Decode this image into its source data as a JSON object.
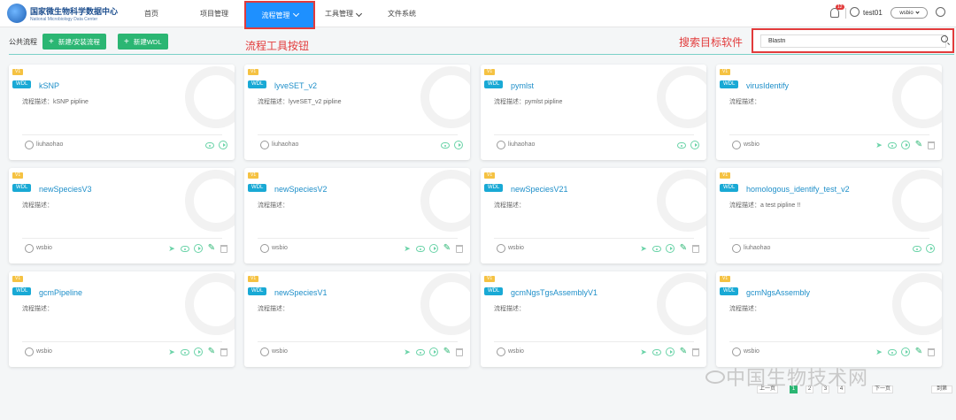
{
  "header": {
    "logo_title": "国家微生物科学数据中心",
    "logo_sub": "National Microbiology Data Center",
    "nav": [
      "首页",
      "项目管理",
      "流程管理",
      "工具管理",
      "文件系统"
    ],
    "notify_count": "12",
    "user": "test01",
    "workspace": "wsbio"
  },
  "toolbar": {
    "label": "公共流程",
    "new_flow": "新建/安装流程",
    "new_wdl": "新建WDL",
    "annotation_tools": "流程工具按钮",
    "annotation_search": "搜索目标软件",
    "search_value": "Blastn"
  },
  "cards": [
    {
      "version": "V1",
      "type": "WDL",
      "name": "kSNP",
      "desc": "流程描述：kSNP pipline",
      "owner": "liuhaohao",
      "actions": [
        "eye",
        "play"
      ]
    },
    {
      "version": "V1",
      "type": "WDL",
      "name": "lyveSET_v2",
      "desc": "流程描述：lyveSET_v2 pipline",
      "owner": "liuhaohao",
      "actions": [
        "eye",
        "play"
      ]
    },
    {
      "version": "V1",
      "type": "WDL",
      "name": "pymlst",
      "desc": "流程描述：pymlst pipline",
      "owner": "liuhaohao",
      "actions": [
        "eye",
        "play"
      ]
    },
    {
      "version": "V1",
      "type": "WDL",
      "name": "virusIdentify",
      "desc": "流程描述：",
      "owner": "wsbio",
      "actions": [
        "send",
        "eye",
        "play",
        "edit",
        "trash"
      ]
    },
    {
      "version": "V1",
      "type": "WDL",
      "name": "newSpeciesV3",
      "desc": "流程描述：",
      "owner": "wsbio",
      "actions": [
        "send",
        "eye",
        "play",
        "edit",
        "trash"
      ]
    },
    {
      "version": "V1",
      "type": "WDL",
      "name": "newSpeciesV2",
      "desc": "流程描述：",
      "owner": "wsbio",
      "actions": [
        "send",
        "eye",
        "play",
        "edit",
        "trash"
      ]
    },
    {
      "version": "V1",
      "type": "WDL",
      "name": "newSpeciesV21",
      "desc": "流程描述：",
      "owner": "wsbio",
      "actions": [
        "send",
        "eye",
        "play",
        "edit",
        "trash"
      ]
    },
    {
      "version": "V1",
      "type": "WDL",
      "name": "homologous_identify_test_v2",
      "desc": "流程描述：a test pipline !!",
      "owner": "liuhaohao",
      "actions": [
        "eye",
        "play"
      ]
    },
    {
      "version": "V1",
      "type": "WDL",
      "name": "gcmPipeline",
      "desc": "流程描述：",
      "owner": "wsbio",
      "actions": [
        "send",
        "eye",
        "play",
        "edit",
        "trash"
      ]
    },
    {
      "version": "V1",
      "type": "WDL",
      "name": "newSpeciesV1",
      "desc": "流程描述：",
      "owner": "wsbio",
      "actions": [
        "send",
        "eye",
        "play",
        "edit",
        "trash"
      ]
    },
    {
      "version": "V1",
      "type": "WDL",
      "name": "gcmNgsTgsAssemblyV1",
      "desc": "流程描述：",
      "owner": "wsbio",
      "actions": [
        "send",
        "eye",
        "play",
        "edit",
        "trash"
      ]
    },
    {
      "version": "V1",
      "type": "WDL",
      "name": "gcmNgsAssembly",
      "desc": "流程描述：",
      "owner": "wsbio",
      "actions": [
        "send",
        "eye",
        "play",
        "edit",
        "trash"
      ]
    }
  ],
  "pagination": {
    "prev": "上一页",
    "pages": [
      "1",
      "2",
      "3",
      "4"
    ],
    "current": "1",
    "next": "下一页",
    "goto": "到第"
  },
  "watermark": "中国生物技术网"
}
